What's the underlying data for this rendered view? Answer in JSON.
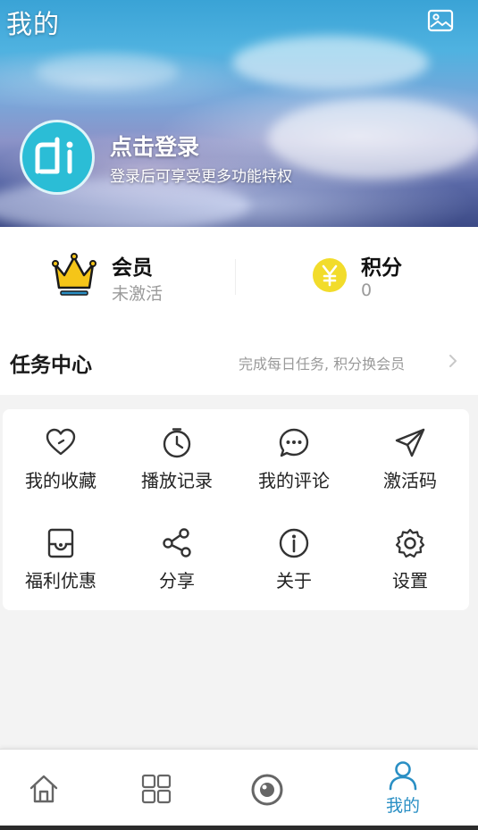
{
  "header": {
    "title": "我的",
    "gallery_icon": "gallery-icon"
  },
  "profile": {
    "avatar_icon": "app-logo-icon",
    "login_title": "点击登录",
    "login_subtitle": "登录后可享受更多功能特权"
  },
  "stats": {
    "vip": {
      "icon": "crown-icon",
      "title": "会员",
      "value": "未激活"
    },
    "points": {
      "icon": "yuan-coin-icon",
      "title": "积分",
      "value": "0"
    }
  },
  "task_center": {
    "title": "任务中心",
    "hint": "完成每日任务, 积分换会员",
    "chevron_icon": "chevron-right-icon"
  },
  "grid": [
    {
      "label": "我的收藏",
      "icon": "heart-icon"
    },
    {
      "label": "播放记录",
      "icon": "clock-icon"
    },
    {
      "label": "我的评论",
      "icon": "chat-bubble-icon"
    },
    {
      "label": "激活码",
      "icon": "send-icon"
    },
    {
      "label": "福利优惠",
      "icon": "coupon-icon"
    },
    {
      "label": "分享",
      "icon": "share-icon"
    },
    {
      "label": "关于",
      "icon": "info-icon"
    },
    {
      "label": "设置",
      "icon": "settings-icon"
    }
  ],
  "bottom_nav": {
    "tabs": [
      {
        "icon": "home-icon",
        "label": ""
      },
      {
        "icon": "category-grid-icon",
        "label": ""
      },
      {
        "icon": "discover-icon",
        "label": ""
      },
      {
        "icon": "profile-icon",
        "label": "我的",
        "active": true
      }
    ]
  },
  "colors": {
    "accent": "#2a8fc4",
    "avatar_bg": "#2bbdd6",
    "crown_gold": "#f5c518",
    "coin_yellow": "#f2dc2b",
    "icon_stroke": "#333333"
  }
}
